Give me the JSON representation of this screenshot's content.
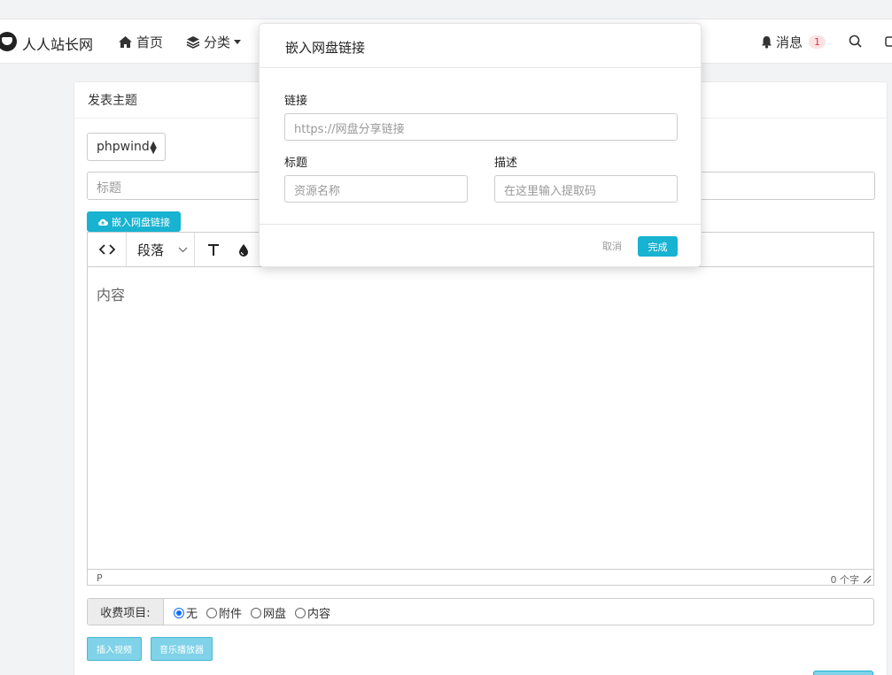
{
  "nav": {
    "brand": "人人站长网",
    "home": "首页",
    "category": "分类",
    "messages": "消息",
    "message_count": "1"
  },
  "post": {
    "section_title": "发表主题",
    "forum_select": "phpwind",
    "title_placeholder": "标题",
    "embed_button": "嵌入网盘链接",
    "paragraph_select": "段落",
    "content_placeholder": "内容",
    "status_tag": "P",
    "char_count": "0 个字",
    "fee_label": "收费项目:",
    "fee_options": [
      "无",
      "附件",
      "网盘",
      "内容"
    ],
    "fee_selected": "无",
    "insert_video": "插入视频",
    "music_player": "音乐播放器"
  },
  "modal": {
    "title": "嵌入网盘链接",
    "link_label": "链接",
    "link_placeholder": "https://网盘分享链接",
    "name_label": "标题",
    "name_placeholder": "资源名称",
    "desc_label": "描述",
    "desc_placeholder": "在这里输入提取码",
    "cancel": "取消",
    "done": "完成"
  },
  "colors": {
    "accent": "#17b3d1",
    "badge": "#dc3545",
    "radio": "#0d6efd"
  }
}
